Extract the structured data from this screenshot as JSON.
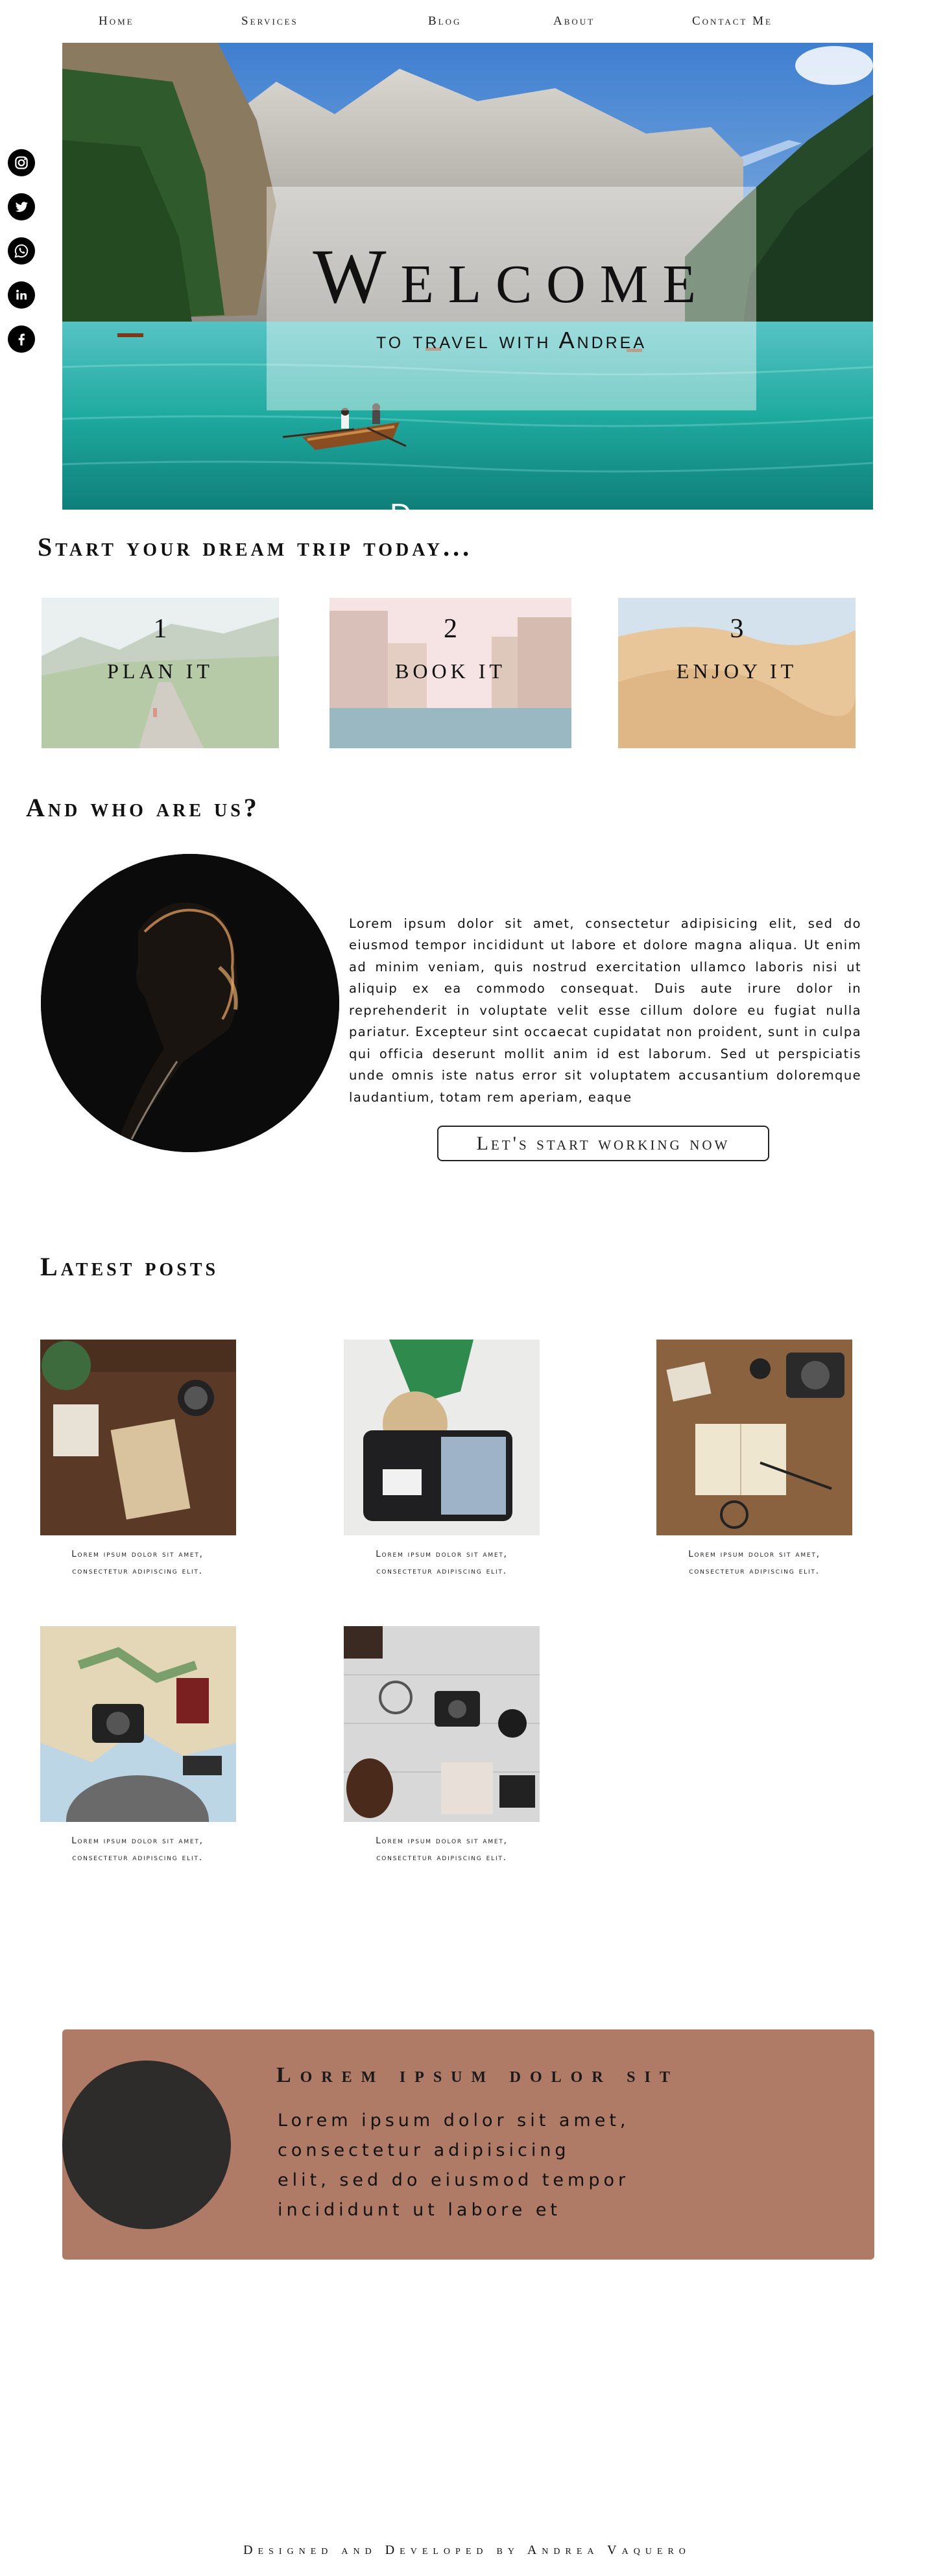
{
  "nav": {
    "items": [
      {
        "label": "Home"
      },
      {
        "label": "Services"
      },
      {
        "label": "Blog"
      },
      {
        "label": "About"
      },
      {
        "label": "Contact Me"
      }
    ]
  },
  "social": [
    {
      "icon": "instagram-icon"
    },
    {
      "icon": "twitter-icon"
    },
    {
      "icon": "whatsapp-icon"
    },
    {
      "icon": "linkedin-icon"
    },
    {
      "icon": "facebook-icon"
    }
  ],
  "hero": {
    "title": "Welcome",
    "subtitle": "to travel with Andrea",
    "discover": "Discover more"
  },
  "steps_section": {
    "heading": "Start your dream trip today...",
    "steps": [
      {
        "number": "1",
        "label": "PLAN IT"
      },
      {
        "number": "2",
        "label": "BOOK IT"
      },
      {
        "number": "3",
        "label": "ENJOY IT"
      }
    ]
  },
  "about": {
    "heading": "And who are us?",
    "text": "Lorem ipsum dolor sit amet, consectetur adipisicing elit, sed do eiusmod tempor incididunt ut labore et dolore magna aliqua. Ut enim ad minim veniam, quis nostrud exercitation ullamco laboris nisi ut aliquip ex ea commodo consequat. Duis aute irure dolor in reprehenderit in voluptate velit esse cillum dolore eu fugiat nulla pariatur. Excepteur sint occaecat cupidatat non proident, sunt in culpa qui officia deserunt mollit anim id est laborum. Sed ut perspiciatis unde omnis iste natus error sit voluptatem accusantium doloremque laudantium, totam rem aperiam, eaque",
    "cta": "Let's start working now"
  },
  "posts": {
    "heading": "Latest posts",
    "items": [
      {
        "caption_line1": "Lorem ipsum dolor sit amet,",
        "caption_line2": "consectetur adipiscing elit."
      },
      {
        "caption_line1": "Lorem ipsum dolor sit amet,",
        "caption_line2": "consectetur adipiscing elit."
      },
      {
        "caption_line1": "Lorem ipsum dolor sit amet,",
        "caption_line2": "consectetur adipiscing elit."
      },
      {
        "caption_line1": "Lorem ipsum dolor sit amet,",
        "caption_line2": "consectetur adipiscing elit."
      },
      {
        "caption_line1": "Lorem ipsum dolor sit amet,",
        "caption_line2": "consectetur adipiscing elit."
      }
    ]
  },
  "banner": {
    "title": "Lorem ipsum dolor sit",
    "text_lines": [
      "Lorem ipsum dolor sit amet,",
      "consectetur adipisicing",
      "elit, sed do eiusmod tempor",
      "incididunt ut labore et"
    ],
    "color": "#b07b66"
  },
  "footer": {
    "text": "Designed and Developed by Andrea Vaquero"
  }
}
